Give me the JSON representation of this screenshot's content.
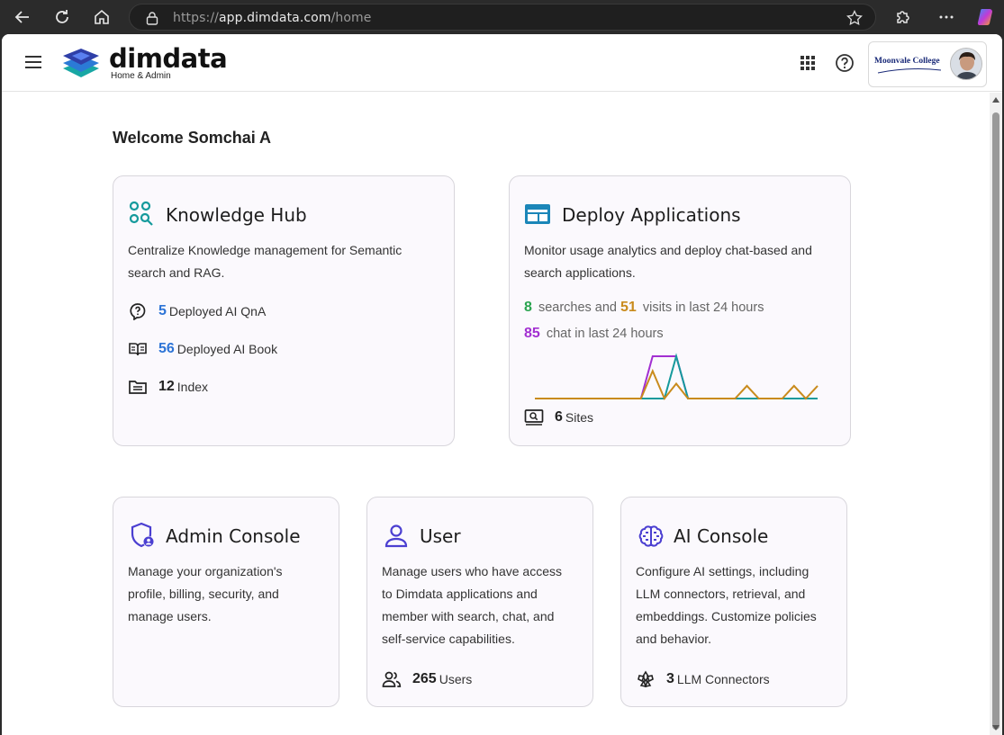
{
  "browser": {
    "url_prefix": "https://",
    "url_host": "app.dimdata.com",
    "url_path": "/home"
  },
  "app": {
    "logo_text": "dimdata",
    "logo_subtitle": "Home & Admin",
    "college_name": "Moonvale College"
  },
  "welcome": "Welcome Somchai A",
  "knowledge_hub": {
    "title": "Knowledge Hub",
    "description": "Centralize Knowledge management for Semantic search and RAG.",
    "stats": [
      {
        "value": "5",
        "label": "Deployed AI QnA"
      },
      {
        "value": "56",
        "label": "Deployed AI Book"
      },
      {
        "value": "12",
        "label": "Index"
      }
    ]
  },
  "deploy": {
    "title": "Deploy Applications",
    "description": "Monitor usage analytics and deploy chat-based and search applications.",
    "searches": "8",
    "searches_label": "searches and",
    "visits": "51",
    "visits_label": "visits in last 24 hours",
    "chats": "85",
    "chats_label": "chat in last 24 hours",
    "sites_value": "6",
    "sites_label": "Sites"
  },
  "admin": {
    "title": "Admin Console",
    "description": "Manage your organization's profile, billing, security, and manage users."
  },
  "user": {
    "title": "User",
    "description": "Manage users who have access to Dimdata applications and member with search, chat, and self-service capabilities.",
    "count": "265",
    "count_label": "Users"
  },
  "ai": {
    "title": "AI Console",
    "description": "Configure AI settings, including LLM connectors, retrieval, and embeddings. Customize policies and behavior.",
    "count": "3",
    "count_label": "LLM Connectors"
  },
  "colors": {
    "searches": "#2aa44f",
    "visits": "#c98b1c",
    "chats": "#a22fd1",
    "teal": "#159a9c",
    "purple_icon": "#4b3fd1"
  },
  "chart_data": {
    "type": "line",
    "x": [
      0,
      1,
      2,
      3,
      4,
      5,
      6,
      7,
      8,
      9,
      10,
      11,
      12,
      13,
      14,
      15,
      16,
      17,
      18,
      19,
      20,
      21,
      22,
      23,
      24
    ],
    "series": [
      {
        "color": "#a22fd1",
        "values": [
          0,
          0,
          0,
          0,
          0,
          0,
          0,
          0,
          0,
          0,
          2,
          2,
          2,
          0,
          0,
          0,
          0,
          0,
          0,
          0,
          0,
          0,
          0,
          0,
          0
        ]
      },
      {
        "color": "#159a9c",
        "values": [
          0,
          0,
          0,
          0,
          0,
          0,
          0,
          0,
          0,
          0,
          0,
          0,
          2,
          0,
          0,
          0,
          0,
          0,
          0,
          0,
          0,
          0,
          0,
          0,
          0
        ]
      },
      {
        "color": "#c98b1c",
        "values": [
          0,
          0,
          0,
          0,
          0,
          0,
          0,
          0,
          0,
          0,
          1.3,
          0,
          0.7,
          0,
          0,
          0,
          0,
          0,
          0.6,
          0,
          0,
          0,
          0.6,
          0,
          0.6
        ]
      }
    ]
  }
}
